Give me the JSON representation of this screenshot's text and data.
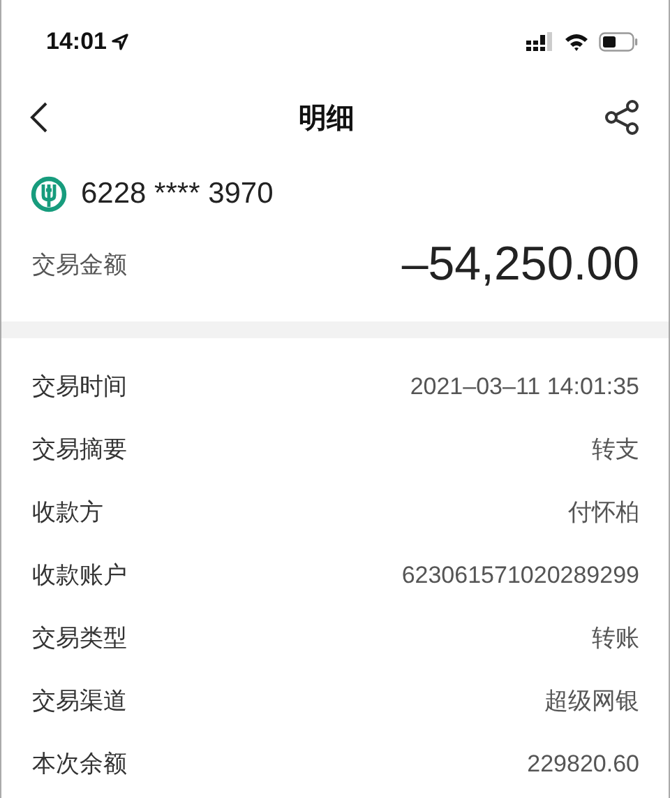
{
  "status_bar": {
    "time": "14:01"
  },
  "nav": {
    "title": "明细"
  },
  "account": {
    "number": "6228 **** 3970"
  },
  "amount": {
    "label": "交易金额",
    "value": "–54,250.00"
  },
  "details": [
    {
      "label": "交易时间",
      "value": "2021–03–11 14:01:35"
    },
    {
      "label": "交易摘要",
      "value": "转支"
    },
    {
      "label": "收款方",
      "value": "付怀柏"
    },
    {
      "label": "收款账户",
      "value": "623061571020289299"
    },
    {
      "label": "交易类型",
      "value": "转账"
    },
    {
      "label": "交易渠道",
      "value": "超级网银"
    },
    {
      "label": "本次余额",
      "value": "229820.60"
    }
  ]
}
